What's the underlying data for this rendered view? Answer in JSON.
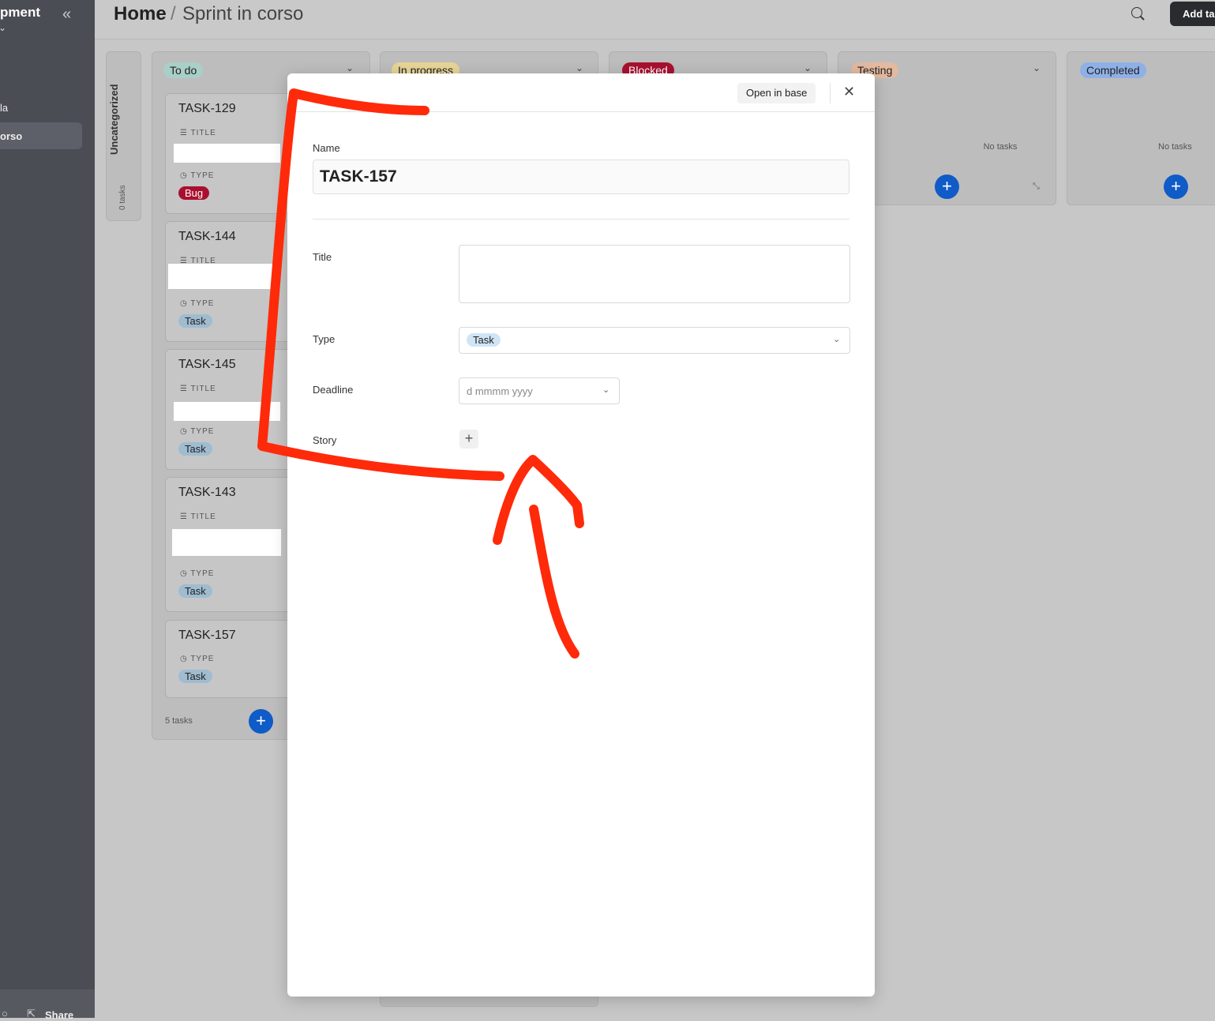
{
  "sidebar": {
    "title": "pment",
    "caret": "⌄",
    "collapse": "«",
    "items": [
      {
        "label": "la"
      },
      {
        "label": "orso"
      }
    ],
    "footer": {
      "share": "Share",
      "share_icon": "⇱",
      "user_icon": "○"
    }
  },
  "header": {
    "home": "Home",
    "separator": "/",
    "current": "Sprint in corso",
    "add_label": "Add ta"
  },
  "board": {
    "uncategorized": {
      "label": "Uncategorized",
      "count": "0 tasks"
    },
    "columns": [
      {
        "name": "To do",
        "color": "#a8cfc8",
        "count": "5 tasks",
        "cards": [
          {
            "id": "TASK-129",
            "title_label": "TITLE",
            "type_label": "TYPE",
            "type": "Bug"
          },
          {
            "id": "TASK-144",
            "title_label": "TITLE",
            "type_label": "TYPE",
            "type": "Task"
          },
          {
            "id": "TASK-145",
            "title_label": "TITLE",
            "type_label": "TYPE",
            "type": "Task"
          },
          {
            "id": "TASK-143",
            "title_label": "TITLE",
            "type_label": "TYPE",
            "type": "Task"
          },
          {
            "id": "TASK-157",
            "type_label": "TYPE",
            "type": "Task"
          }
        ]
      },
      {
        "name": "In progress",
        "color": "#e8d597"
      },
      {
        "name": "Blocked",
        "color": "#a9102f"
      },
      {
        "name": "Testing",
        "color": "#e4b9a0",
        "empty": "No tasks"
      },
      {
        "name": "Completed",
        "color": "#8fb0e6",
        "empty": "No tasks"
      }
    ]
  },
  "modal": {
    "open_in_base": "Open in base",
    "name_label": "Name",
    "name_value": "TASK-157",
    "title_label": "Title",
    "type_label": "Type",
    "type_value": "Task",
    "deadline_label": "Deadline",
    "deadline_placeholder": "d mmmm yyyy",
    "story_label": "Story"
  },
  "annotation": {
    "color": "#ff2a0a"
  }
}
